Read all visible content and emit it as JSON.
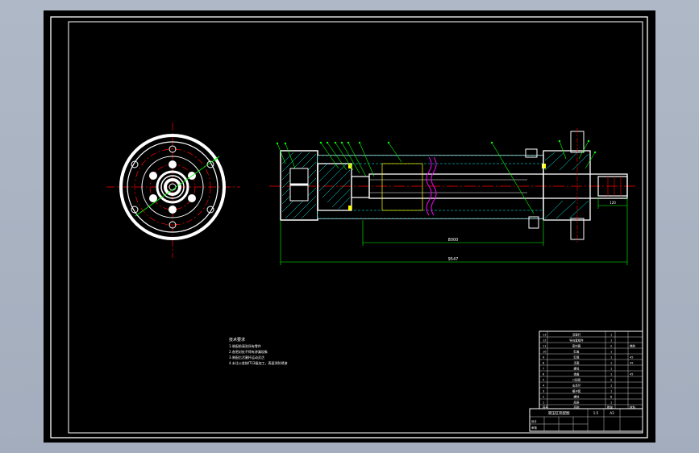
{
  "sheet": {
    "background": "#000000",
    "frame_color": "#ffffff",
    "centerline_color": "#ff0000",
    "dimension_color": "#00ff00",
    "hatch_color": "#00ffff",
    "leader_color": "#00ff00",
    "outline_color": "#ffffff",
    "accent_color": "#ff00ff",
    "marker_color": "#ffff00"
  },
  "views": {
    "end_view": {
      "bolt_holes": 6,
      "outer_bolts": 4
    },
    "section_view": {
      "balloon_count": 13
    }
  },
  "dimensions": {
    "inner_length": "8000",
    "overall_length": "9547",
    "shaft_end": "120"
  },
  "notes": {
    "heading": "技术要求",
    "lines": [
      "1.装配前清洗所有零件",
      "2.各密封处不得有渗漏现象",
      "3.装配后活塞杆运动灵活",
      "4.未注公差按IT12级加工，表面涂防锈漆"
    ]
  },
  "title_block": {
    "rows": [
      [
        "13",
        "活塞杆",
        "1",
        ""
      ],
      [
        "12",
        "导向套组件",
        "1",
        ""
      ],
      [
        "11",
        "密封圈",
        "2",
        "橡胶"
      ],
      [
        "10",
        "缸盖",
        "1",
        ""
      ],
      [
        "9",
        "缸筒",
        "1",
        "45"
      ],
      [
        "8",
        "活塞",
        "1",
        "45"
      ],
      [
        "7",
        "螺母",
        "1",
        ""
      ],
      [
        "6",
        "端盖",
        "1",
        "45"
      ],
      [
        "5",
        "O形圈",
        "2",
        ""
      ],
      [
        "4",
        "支承环",
        "1",
        ""
      ],
      [
        "3",
        "缓冲套",
        "1",
        ""
      ],
      [
        "2",
        "螺栓",
        "8",
        ""
      ],
      [
        "1",
        "底座",
        "1",
        ""
      ]
    ],
    "header": [
      "序号",
      "名称",
      "数量",
      "材料"
    ],
    "title": "液压缸装配图",
    "scale": "1:5",
    "sheet_no": "A3",
    "designer": "设计",
    "checker": "审核"
  }
}
